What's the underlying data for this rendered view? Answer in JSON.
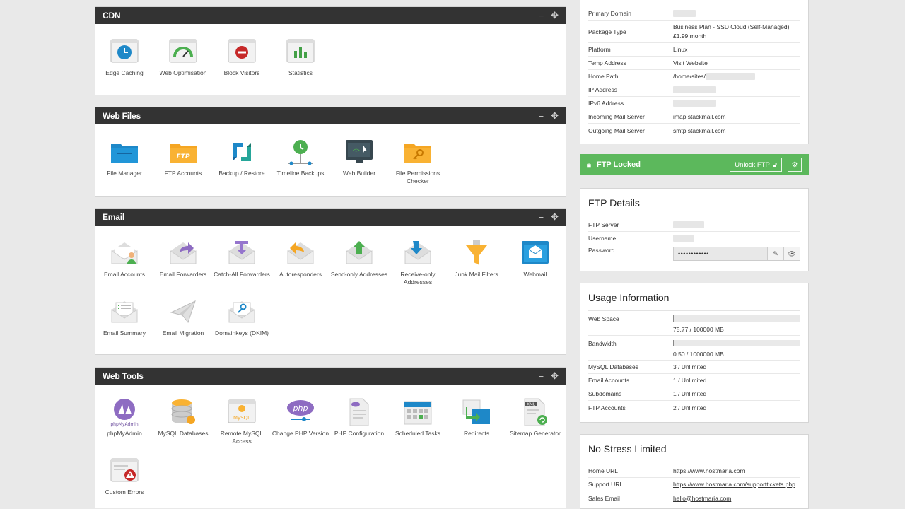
{
  "panels": {
    "cdn": {
      "title": "CDN",
      "items": [
        "Edge Caching",
        "Web Optimisation",
        "Block Visitors",
        "Statistics"
      ]
    },
    "web_files": {
      "title": "Web Files",
      "items": [
        "File Manager",
        "FTP Accounts",
        "Backup / Restore",
        "Timeline Backups",
        "Web Builder",
        "File Permissions Checker"
      ]
    },
    "email": {
      "title": "Email",
      "items": [
        "Email Accounts",
        "Email Forwarders",
        "Catch-All Forwarders",
        "Autoresponders",
        "Send-only Addresses",
        "Receive-only Addresses",
        "Junk Mail Filters",
        "Webmail",
        "Email Summary",
        "Email Migration",
        "Domainkeys (DKIM)"
      ]
    },
    "web_tools": {
      "title": "Web Tools",
      "items": [
        "phpMyAdmin",
        "MySQL Databases",
        "Remote MySQL Access",
        "Change PHP Version",
        "PHP Configuration",
        "Scheduled Tasks",
        "Redirects",
        "Sitemap Generator",
        "Custom Errors"
      ]
    }
  },
  "hosting_info": {
    "rows": [
      {
        "k": "Primary Domain",
        "v": ""
      },
      {
        "k": "Package Type",
        "v": "Business Plan - SSD Cloud (Self-Managed) £1.99 month"
      },
      {
        "k": "Platform",
        "v": "Linux"
      },
      {
        "k": "Temp Address",
        "v": "Visit Website"
      },
      {
        "k": "Home Path",
        "v": "/home/sites/"
      },
      {
        "k": "IP Address",
        "v": ""
      },
      {
        "k": "IPv6 Address",
        "v": ""
      },
      {
        "k": "Incoming Mail Server",
        "v": "imap.stackmail.com"
      },
      {
        "k": "Outgoing Mail Server",
        "v": "smtp.stackmail.com"
      }
    ]
  },
  "ftp_lock": {
    "status": "FTP Locked",
    "unlock_label": "Unlock FTP",
    "accent": "#5cb85c"
  },
  "ftp_details": {
    "title": "FTP Details",
    "server_label": "FTP Server",
    "username_label": "Username",
    "password_label": "Password",
    "password_mask": "••••••••••••"
  },
  "usage": {
    "title": "Usage Information",
    "web_space_label": "Web Space",
    "web_space_value": "75.77 / 100000 MB",
    "web_space_fraction": 0.00076,
    "bandwidth_label": "Bandwidth",
    "bandwidth_value": "0.50 / 1000000 MB",
    "bandwidth_fraction": 5e-07,
    "rows": [
      {
        "k": "MySQL Databases",
        "v": "3 / Unlimited"
      },
      {
        "k": "Email Accounts",
        "v": "1 / Unlimited"
      },
      {
        "k": "Subdomains",
        "v": "1 / Unlimited"
      },
      {
        "k": "FTP Accounts",
        "v": "2 / Unlimited"
      }
    ]
  },
  "company": {
    "title": "No Stress Limited",
    "rows": [
      {
        "k": "Home URL",
        "v": "https://www.hostmaria.com"
      },
      {
        "k": "Support URL",
        "v": "https://www.hostmaria.com/supporttickets.php"
      },
      {
        "k": "Sales Email",
        "v": "hello@hostmaria.com"
      }
    ]
  }
}
